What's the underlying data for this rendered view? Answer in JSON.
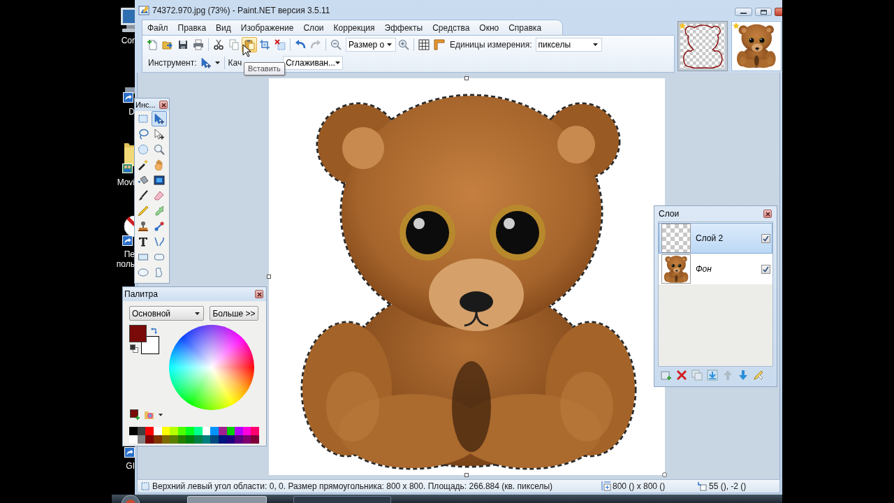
{
  "desktop_icons": [
    {
      "kind": "computer",
      "lines": [
        "Cor"
      ]
    },
    {
      "kind": "shortcut",
      "lines": [
        "D"
      ]
    },
    {
      "kind": "folder",
      "lines": [
        "Movi"
      ]
    },
    {
      "kind": "sign",
      "lines": [
        "Пе",
        "поль"
      ]
    },
    {
      "kind": "link",
      "lines": [
        "GI"
      ]
    }
  ],
  "window": {
    "title": "74372.970.jpg (73%) - Paint.NET версия 3.5.11"
  },
  "menu": [
    "Файл",
    "Правка",
    "Вид",
    "Изображение",
    "Слои",
    "Коррекция",
    "Эффекты",
    "Средства",
    "Окно",
    "Справка"
  ],
  "toolbar": {
    "groups": [
      [
        {
          "kind": "new",
          "disabled": false,
          "hovered": false
        },
        {
          "kind": "open",
          "disabled": false,
          "hovered": false
        },
        {
          "kind": "save",
          "disabled": false,
          "hovered": false
        },
        {
          "kind": "print",
          "disabled": false,
          "hovered": false
        }
      ],
      [
        {
          "kind": "cut",
          "disabled": false,
          "hovered": false
        },
        {
          "kind": "copy",
          "disabled": false,
          "hovered": false
        },
        {
          "kind": "paste",
          "disabled": false,
          "hovered": true
        },
        {
          "kind": "crop",
          "disabled": false,
          "hovered": false
        },
        {
          "kind": "deselect",
          "disabled": false,
          "hovered": false
        }
      ],
      [
        {
          "kind": "undo",
          "disabled": false,
          "hovered": false
        },
        {
          "kind": "redo",
          "disabled": true,
          "hovered": false
        }
      ],
      [
        {
          "kind": "zoom-out",
          "disabled": false,
          "hovered": false
        },
        {
          "kind": "dropdown",
          "value": "Размер о"
        },
        {
          "kind": "zoom-in",
          "disabled": false,
          "hovered": false
        }
      ],
      [
        {
          "kind": "grid",
          "disabled": false,
          "hovered": false
        },
        {
          "kind": "ruler",
          "disabled": false,
          "hovered": false
        },
        {
          "kind": "label",
          "text": "Единицы измерения:"
        },
        {
          "kind": "dropdown",
          "value": "пикселы"
        }
      ]
    ]
  },
  "options_bar": {
    "tool_label": "Инструмент:",
    "quality_label": "Кач",
    "quality_value": "Сглаживан..."
  },
  "tooltip": "Вставить",
  "image_tabs": [
    {
      "kind": "outline",
      "modified": true,
      "selected": false
    },
    {
      "kind": "photo",
      "modified": true,
      "selected": true
    }
  ],
  "tools_window": {
    "title": "Инс...",
    "tools": [
      {
        "kind": "rect-select",
        "selected": false
      },
      {
        "kind": "move-pixels",
        "selected": true
      },
      {
        "kind": "lasso",
        "selected": false
      },
      {
        "kind": "move-selection",
        "selected": false
      },
      {
        "kind": "ellipse-select",
        "selected": false
      },
      {
        "kind": "zoom",
        "selected": false
      },
      {
        "kind": "magic-wand",
        "selected": false
      },
      {
        "kind": "pan",
        "selected": false
      },
      {
        "kind": "bucket",
        "selected": false
      },
      {
        "kind": "gradient",
        "selected": false
      },
      {
        "kind": "brush",
        "selected": false
      },
      {
        "kind": "eraser",
        "selected": false
      },
      {
        "kind": "pencil",
        "selected": false
      },
      {
        "kind": "picker",
        "selected": false
      },
      {
        "kind": "clone-stamp",
        "selected": false
      },
      {
        "kind": "recolor",
        "selected": false
      },
      {
        "kind": "text",
        "selected": false
      },
      {
        "kind": "line",
        "selected": false
      },
      {
        "kind": "rectangle",
        "selected": false
      },
      {
        "kind": "rounded-rectangle",
        "selected": false
      },
      {
        "kind": "ellipse",
        "selected": false
      },
      {
        "kind": "freeform",
        "selected": false
      }
    ]
  },
  "palette_window": {
    "title": "Палитра",
    "mode": "Основной",
    "more_button": "Больше >>",
    "current_colors": [
      {
        "color": "#7a0a0a"
      },
      {
        "color": "#ffffff"
      }
    ],
    "swatches": [
      {
        "color": "#000000"
      },
      {
        "color": "#404040"
      },
      {
        "color": "#ff0000"
      },
      {
        "color": "#ffffff"
      },
      {
        "color": "#ffff00"
      },
      {
        "color": "#b6ff00"
      },
      {
        "color": "#4cff00"
      },
      {
        "color": "#00ff21"
      },
      {
        "color": "#00ff90"
      },
      {
        "color": "#ffffff"
      },
      {
        "color": "#0094ff"
      },
      {
        "color": "#a0208f"
      },
      {
        "color": "#00d000"
      },
      {
        "color": "#b200ff"
      },
      {
        "color": "#ff00dc"
      },
      {
        "color": "#ff006e"
      },
      {
        "color": "#ffffff"
      },
      {
        "color": "#808080"
      },
      {
        "color": "#7f0000"
      },
      {
        "color": "#7f3300"
      },
      {
        "color": "#7f6a00"
      },
      {
        "color": "#5b7f00"
      },
      {
        "color": "#267f00"
      },
      {
        "color": "#007f0e"
      },
      {
        "color": "#007f46"
      },
      {
        "color": "#007f7f"
      },
      {
        "color": "#004a7f"
      },
      {
        "color": "#00137f"
      },
      {
        "color": "#21007f"
      },
      {
        "color": "#57007f"
      },
      {
        "color": "#7f006e"
      },
      {
        "color": "#7f0037"
      }
    ]
  },
  "layers_window": {
    "title": "Слои",
    "layers": [
      {
        "kind": "layer",
        "name": "Слой 2",
        "selected": true,
        "visible": true
      },
      {
        "kind": "background",
        "name": "Фон",
        "selected": false,
        "visible": true
      }
    ],
    "buttons": [
      {
        "kind": "add",
        "disabled": false
      },
      {
        "kind": "delete",
        "disabled": false
      },
      {
        "kind": "duplicate",
        "disabled": false
      },
      {
        "kind": "merge",
        "disabled": false
      },
      {
        "kind": "up",
        "disabled": true
      },
      {
        "kind": "down",
        "disabled": false
      },
      {
        "kind": "properties",
        "disabled": false
      }
    ]
  },
  "status_bar": {
    "selection_info": "Верхний левый угол области: 0, 0. Размер прямоугольника: 800 x 800. Площадь: 266.884 (кв. пикселы)",
    "size": "800 () x 800 ()",
    "offset": "55 (), -2 ()"
  }
}
